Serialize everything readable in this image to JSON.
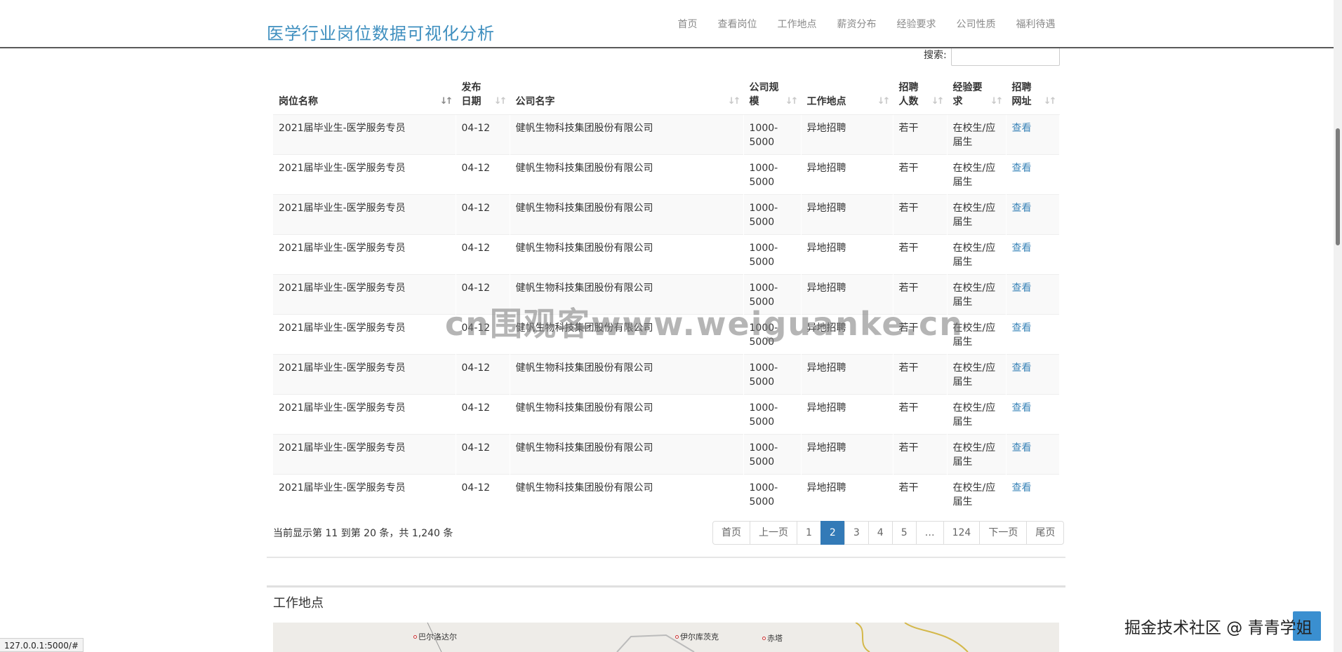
{
  "navbar": {
    "brand": "医学行业岗位数据可视化分析",
    "links": [
      "首页",
      "查看岗位",
      "工作地点",
      "薪资分布",
      "经验要求",
      "公司性质",
      "福利待遇"
    ]
  },
  "search": {
    "label": "搜索:",
    "value": ""
  },
  "table": {
    "headers": [
      {
        "line1": "岗位名称",
        "line2": ""
      },
      {
        "line1": "发布",
        "line2": "日期"
      },
      {
        "line1": "公司名字",
        "line2": ""
      },
      {
        "line1": "公司规",
        "line2": "模"
      },
      {
        "line1": "工作地点",
        "line2": ""
      },
      {
        "line1": "招聘",
        "line2": "人数"
      },
      {
        "line1": "经验要",
        "line2": "求"
      },
      {
        "line1": "招聘",
        "line2": "网址"
      }
    ],
    "rows": [
      {
        "title": "2021届毕业生-医学服务专员",
        "date": "04-12",
        "company": "健帆生物科技集团股份有限公司",
        "size1": "1000-",
        "size2": "5000",
        "location": "异地招聘",
        "count": "若干",
        "exp1": "在校生/应",
        "exp2": "届生",
        "link": "查看"
      },
      {
        "title": "2021届毕业生-医学服务专员",
        "date": "04-12",
        "company": "健帆生物科技集团股份有限公司",
        "size1": "1000-",
        "size2": "5000",
        "location": "异地招聘",
        "count": "若干",
        "exp1": "在校生/应",
        "exp2": "届生",
        "link": "查看"
      },
      {
        "title": "2021届毕业生-医学服务专员",
        "date": "04-12",
        "company": "健帆生物科技集团股份有限公司",
        "size1": "1000-",
        "size2": "5000",
        "location": "异地招聘",
        "count": "若干",
        "exp1": "在校生/应",
        "exp2": "届生",
        "link": "查看"
      },
      {
        "title": "2021届毕业生-医学服务专员",
        "date": "04-12",
        "company": "健帆生物科技集团股份有限公司",
        "size1": "1000-",
        "size2": "5000",
        "location": "异地招聘",
        "count": "若干",
        "exp1": "在校生/应",
        "exp2": "届生",
        "link": "查看"
      },
      {
        "title": "2021届毕业生-医学服务专员",
        "date": "04-12",
        "company": "健帆生物科技集团股份有限公司",
        "size1": "1000-",
        "size2": "5000",
        "location": "异地招聘",
        "count": "若干",
        "exp1": "在校生/应",
        "exp2": "届生",
        "link": "查看"
      },
      {
        "title": "2021届毕业生-医学服务专员",
        "date": "04-12",
        "company": "健帆生物科技集团股份有限公司",
        "size1": "1000-",
        "size2": "5000",
        "location": "异地招聘",
        "count": "若干",
        "exp1": "在校生/应",
        "exp2": "届生",
        "link": "查看"
      },
      {
        "title": "2021届毕业生-医学服务专员",
        "date": "04-12",
        "company": "健帆生物科技集团股份有限公司",
        "size1": "1000-",
        "size2": "5000",
        "location": "异地招聘",
        "count": "若干",
        "exp1": "在校生/应",
        "exp2": "届生",
        "link": "查看"
      },
      {
        "title": "2021届毕业生-医学服务专员",
        "date": "04-12",
        "company": "健帆生物科技集团股份有限公司",
        "size1": "1000-",
        "size2": "5000",
        "location": "异地招聘",
        "count": "若干",
        "exp1": "在校生/应",
        "exp2": "届生",
        "link": "查看"
      },
      {
        "title": "2021届毕业生-医学服务专员",
        "date": "04-12",
        "company": "健帆生物科技集团股份有限公司",
        "size1": "1000-",
        "size2": "5000",
        "location": "异地招聘",
        "count": "若干",
        "exp1": "在校生/应",
        "exp2": "届生",
        "link": "查看"
      },
      {
        "title": "2021届毕业生-医学服务专员",
        "date": "04-12",
        "company": "健帆生物科技集团股份有限公司",
        "size1": "1000-",
        "size2": "5000",
        "location": "异地招聘",
        "count": "若干",
        "exp1": "在校生/应",
        "exp2": "届生",
        "link": "查看"
      }
    ]
  },
  "info": "当前显示第 11 到第 20 条，共 1,240 条",
  "pagination": {
    "first": "首页",
    "prev": "上一页",
    "pages": [
      "1",
      "2",
      "3",
      "4",
      "5",
      "…",
      "124"
    ],
    "active_page": "2",
    "next": "下一页",
    "last": "尾页"
  },
  "map_section": {
    "title": "工作地点",
    "cities": [
      "巴尔洛达尔",
      "伊尔库茨克",
      "赤塔"
    ]
  },
  "overlays": {
    "watermark_center": "cn围观客www.weiguanke.cn",
    "watermark_corner": "掘金技术社区 @ 青青学姐",
    "status_url": "127.0.0.1:5000/#"
  },
  "colors": {
    "brand": "#3f8fbf",
    "link": "#3a84b8",
    "active_page": "#337ab7"
  }
}
